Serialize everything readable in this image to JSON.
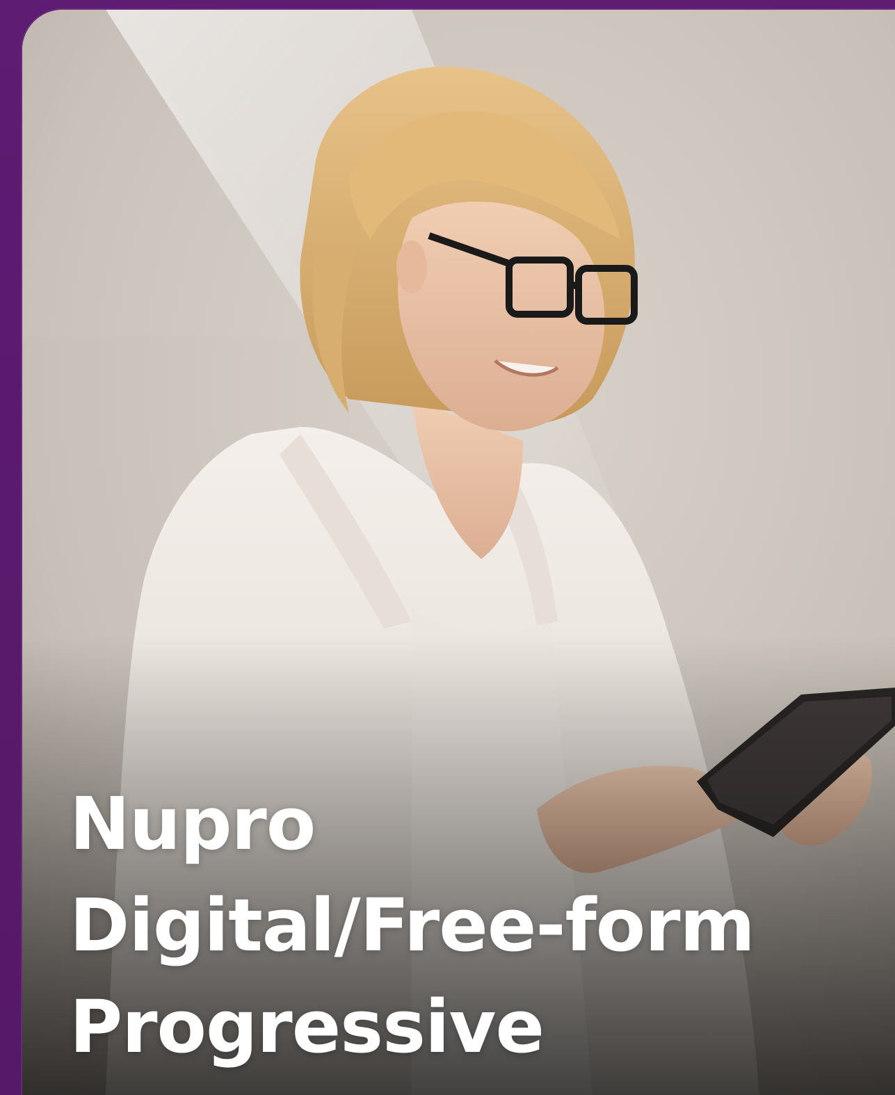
{
  "card": {
    "title_lines": [
      "Nupro",
      "Digital/Free-form",
      "Progressive"
    ],
    "image_subject": "woman-with-glasses-using-tablet"
  },
  "colors": {
    "frame_purple": "#5a1a6e",
    "title_text": "#ffffff"
  }
}
